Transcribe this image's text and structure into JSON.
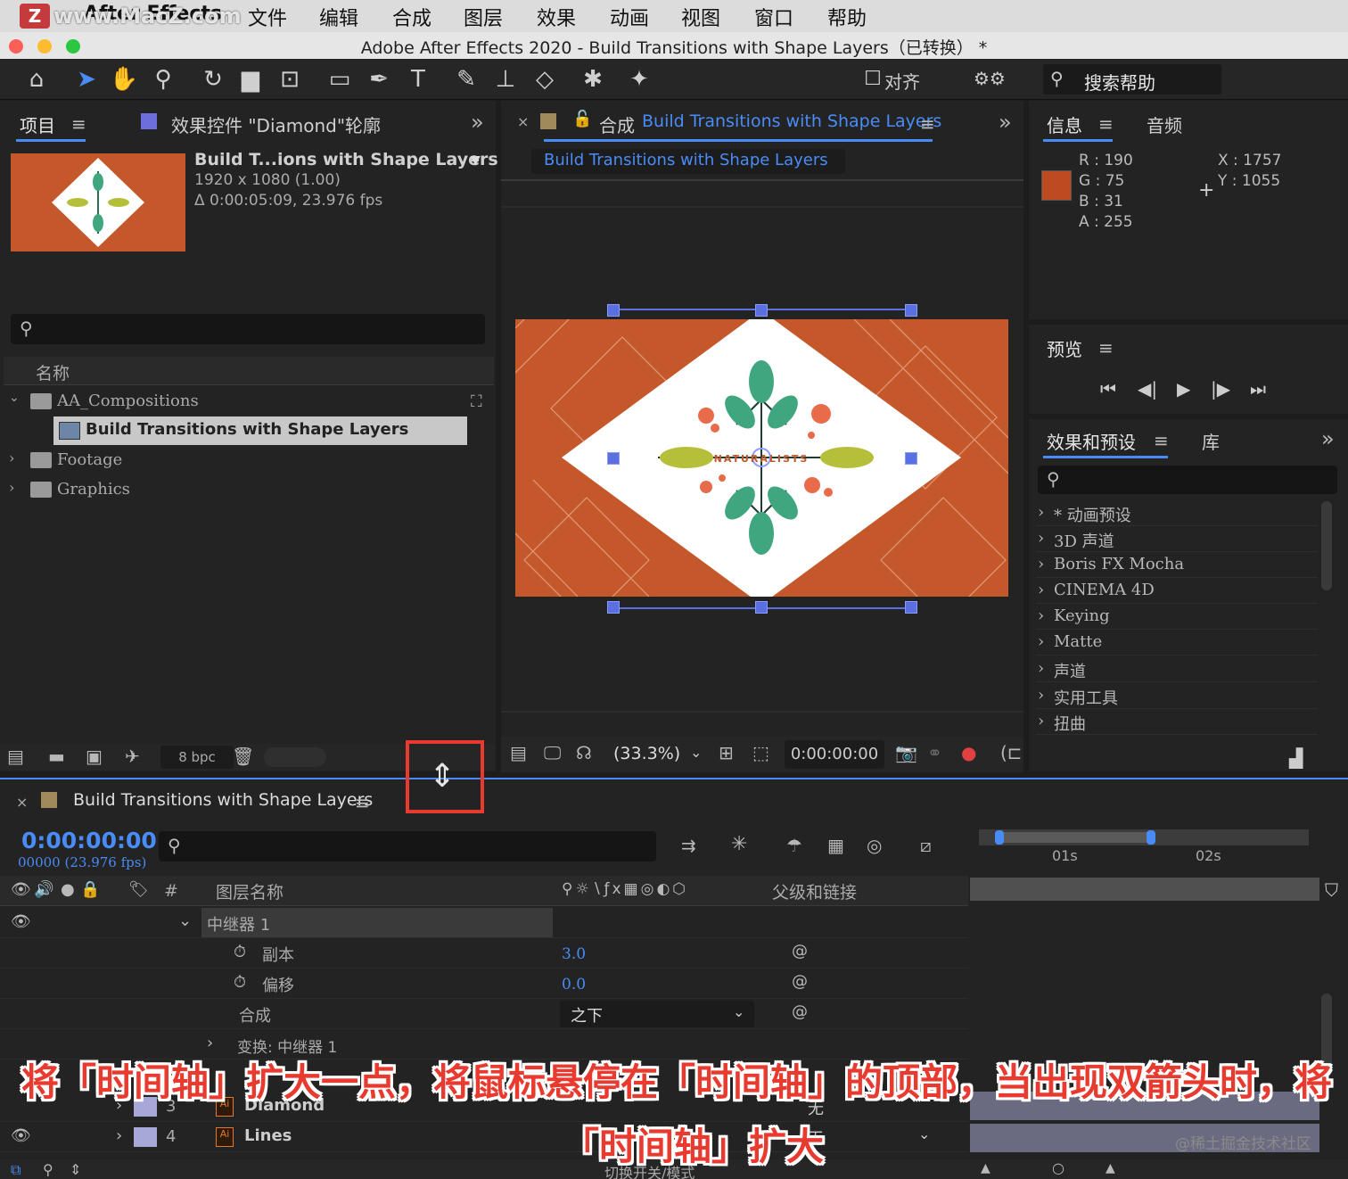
{
  "menubar": {
    "watermark": "www.MacZ.com",
    "logo": "Z",
    "app": "After Effects",
    "items": [
      "文件",
      "编辑",
      "合成",
      "图层",
      "效果",
      "动画",
      "视图",
      "窗口",
      "帮助"
    ]
  },
  "window": {
    "title": "Adobe After Effects 2020 - Build Transitions with Shape Layers（已转换） *"
  },
  "toolbar": {
    "align_label": "对齐",
    "search_placeholder": "搜索帮助"
  },
  "project": {
    "tab_label": "项目",
    "effects_tab_label": "效果控件 \"Diamond\"轮廓",
    "comp_name": "Build T...ions with Shape Layers",
    "dims": "1920 x 1080 (1.00)",
    "duration": "Δ 0:00:05:09, 23.976 fps",
    "column_name": "名称",
    "items": [
      {
        "label": "AA_Compositions",
        "type": "folder",
        "expanded": true
      },
      {
        "label": "Build Transitions with Shape Layers",
        "type": "comp",
        "selected": true
      },
      {
        "label": "Footage",
        "type": "folder"
      },
      {
        "label": "Graphics",
        "type": "folder"
      }
    ],
    "bpc": "8 bpc"
  },
  "composition": {
    "tab_prefix": "合成",
    "tab_name": "Build Transitions with Shape Layers",
    "breadcrumb": "Build Transitions with Shape Layers",
    "artwork_text": "NATURALISTS",
    "zoom": "(33.3%)",
    "timecode": "0:00:00:00"
  },
  "info": {
    "tab_label": "信息",
    "audio_tab_label": "音频",
    "r": "R :  190",
    "g": "G :  75",
    "b": "B :  31",
    "a": "A :  255",
    "x": "X : 1757",
    "y": "Y :  1055",
    "swatch_color": "#be4b1f"
  },
  "preview": {
    "tab_label": "预览"
  },
  "effects": {
    "tab_label": "效果和预设",
    "library_tab_label": "库",
    "items": [
      "* 动画预设",
      "3D 声道",
      "Boris FX Mocha",
      "CINEMA 4D",
      "Keying",
      "Matte",
      "声道",
      "实用工具",
      "扭曲"
    ]
  },
  "timeline": {
    "tab_label": "Build Transitions with Shape Layers",
    "timecode": "0:00:00:00",
    "frames": "00000 (23.976 fps)",
    "col_num": "#",
    "col_layer_name": "图层名称",
    "col_parent": "父级和链接",
    "ruler": [
      "01s",
      "02s"
    ],
    "rows": [
      {
        "name": "中继器 1",
        "kind": "group"
      },
      {
        "name": "副本",
        "value": "3.0",
        "kind": "prop"
      },
      {
        "name": "偏移",
        "value": "0.0",
        "kind": "prop"
      },
      {
        "name": "合成",
        "value": "之下",
        "kind": "select"
      },
      {
        "name": "变换: 中继器 1",
        "kind": "sub"
      },
      {
        "num": "3",
        "name": "Diamond",
        "parent": "无",
        "kind": "layer"
      },
      {
        "num": "4",
        "name": "Lines",
        "parent": "无",
        "kind": "layer"
      }
    ],
    "footer": "切换开关/模式"
  },
  "caption": {
    "line1": "将「时间轴」扩大一点，将鼠标悬停在「时间轴」的顶部，当出现双箭头时，将",
    "line2": "「时间轴」扩大",
    "credit": "@稀土掘金技术社区"
  },
  "colors": {
    "accent": "#4a8cf7",
    "art_orange": "#c4582a",
    "caption_red": "#e83a2e"
  }
}
